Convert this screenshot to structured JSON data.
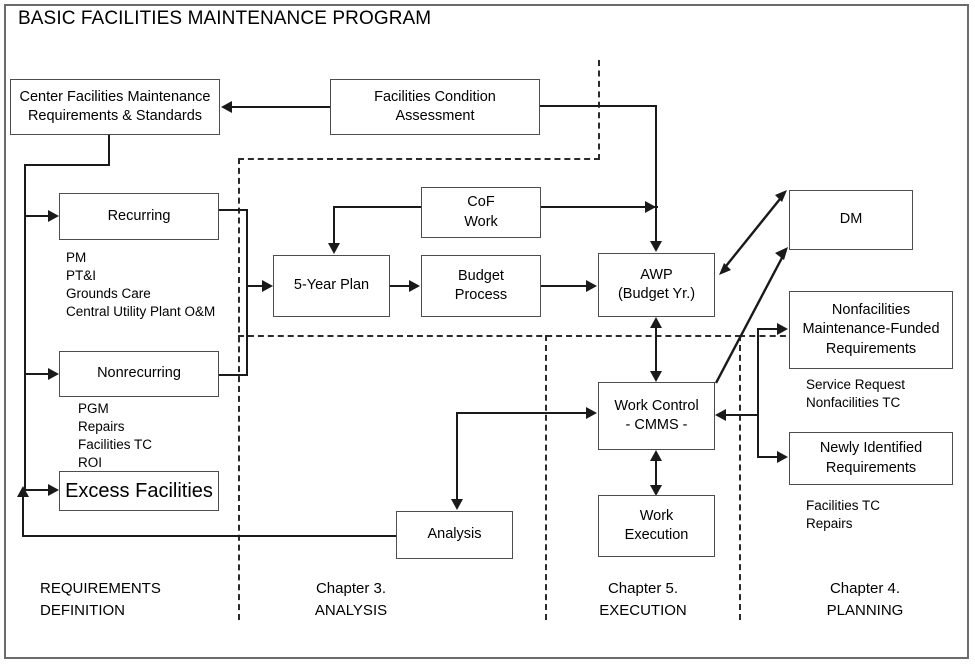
{
  "title": "BASIC FACILITIES MAINTENANCE PROGRAM",
  "boxes": {
    "center_requirements": "Center Facilities Maintenance\nRequirements & Standards",
    "facilities_condition_assessment": "Facilities Condition\nAssessment",
    "recurring": "Recurring",
    "nonrecurring": "Nonrecurring",
    "excess_facilities": "Excess Facilities",
    "cof_work": "CoF\nWork",
    "five_year_plan": "5-Year Plan",
    "budget_process": "Budget\nProcess",
    "awp": "AWP\n(Budget Yr.)",
    "dm": "DM",
    "work_control": "Work Control\n- CMMS -",
    "work_execution": "Work\nExecution",
    "analysis": "Analysis",
    "nonfacilities_requirements": "Nonfacilities\nMaintenance-Funded\nRequirements",
    "newly_identified": "Newly Identified\nRequirements"
  },
  "annotations": {
    "recurring_items": "PM\nPT&I\nGrounds Care\nCentral Utility Plant O&M",
    "nonrecurring_items": "PGM\nRepairs\nFacilities TC\nROI",
    "nonfacilities_items": "Service Request\nNonfacilities TC",
    "newly_identified_items": "Facilities TC\nRepairs"
  },
  "captions": {
    "requirements_definition": "REQUIREMENTS\nDEFINITION",
    "chapter_3": "Chapter 3.\nANALYSIS",
    "chapter_5": "Chapter 5.\nEXECUTION",
    "chapter_4": "Chapter 4.\nPLANNING"
  },
  "colors": {
    "frame": "#6b6b6b",
    "box_border": "#4d4d4d",
    "connector": "#1a1a1a",
    "dashed": "#2b2b2b",
    "background": "#ffffff"
  }
}
